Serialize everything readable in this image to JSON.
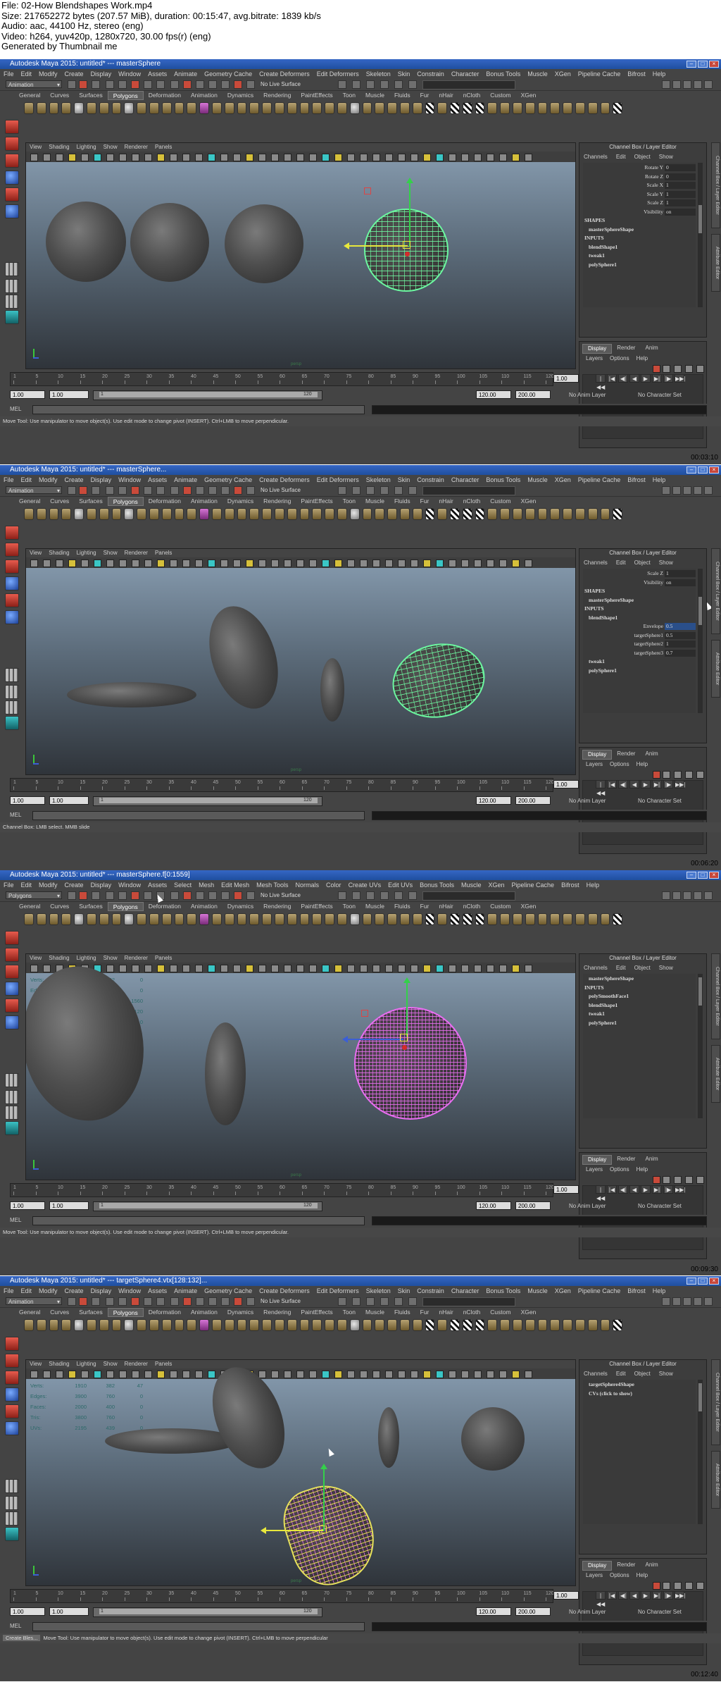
{
  "header": {
    "file": "File: 02-How Blendshapes Work.mp4",
    "size": "Size: 217652272 bytes (207.57 MiB), duration: 00:15:47, avg.bitrate: 1839 kb/s",
    "audio": "Audio: aac, 44100 Hz, stereo (eng)",
    "video": "Video: h264, yuv420p, 1280x720, 30.00 fps(r) (eng)",
    "generator": "Generated by Thumbnail me"
  },
  "common": {
    "menus_animation": [
      "File",
      "Edit",
      "Modify",
      "Create",
      "Display",
      "Window",
      "Assets",
      "Animate",
      "Geometry Cache",
      "Create Deformers",
      "Edit Deformers",
      "Skeleton",
      "Skin",
      "Constrain",
      "Character",
      "Bonus Tools",
      "Muscle",
      "XGen",
      "Pipeline Cache",
      "Bifrost",
      "Help"
    ],
    "menus_polygons": [
      "File",
      "Edit",
      "Modify",
      "Create",
      "Display",
      "Window",
      "Assets",
      "Select",
      "Mesh",
      "Edit Mesh",
      "Mesh Tools",
      "Normals",
      "Color",
      "Create UVs",
      "Edit UVs",
      "Bonus Tools",
      "Muscle",
      "XGen",
      "Pipeline Cache",
      "Bifrost",
      "Help"
    ],
    "shelf_tabs": [
      "General",
      "Curves",
      "Surfaces",
      "Polygons",
      "Deformation",
      "Animation",
      "Dynamics",
      "Rendering",
      "PaintEffects",
      "Toon",
      "Muscle",
      "Fluids",
      "Fur",
      "nHair",
      "nCloth",
      "Custom",
      "XGen"
    ],
    "shelf_selected": "Polygons",
    "live_surface": "No Live Surface",
    "viewport_menu": [
      "View",
      "Shading",
      "Lighting",
      "Show",
      "Renderer",
      "Panels"
    ],
    "channel_box_title": "Channel Box / Layer Editor",
    "channel_menu": [
      "Channels",
      "Edit",
      "Object",
      "Show"
    ],
    "layer_tabs": [
      "Display",
      "Render",
      "Anim"
    ],
    "layer_menu": [
      "Layers",
      "Options",
      "Help"
    ],
    "side_tabs": [
      "Channel Box / Layer Editor",
      "Attribute Editor"
    ],
    "time_ticks": [
      "1",
      "5",
      "10",
      "15",
      "20",
      "25",
      "30",
      "35",
      "40",
      "45",
      "50",
      "55",
      "60",
      "65",
      "70",
      "75",
      "80",
      "85",
      "90",
      "95",
      "100",
      "105",
      "110",
      "115",
      "120"
    ],
    "current_frame": "1.00",
    "range_start": "1.00",
    "range_start2": "1.00",
    "range_inner_start": "1",
    "range_inner_end": "120",
    "range_end": "120.00",
    "range_end2": "200.00",
    "anim_layer": "No Anim Layer",
    "char_set": "No Character Set",
    "mel": "MEL",
    "persp": "persp",
    "play_buttons": [
      "|◀◀",
      "|◀",
      "◀|",
      "◀",
      "▶",
      "▶|",
      "|▶",
      "▶▶|"
    ]
  },
  "frames": [
    {
      "title": "Autodesk Maya 2015: untitled*   ---   masterSphere",
      "menu_set": "Animation",
      "timestamp": "00:03:10",
      "help": "Move Tool: Use manipulator to move object(s). Use edit mode to change pivot (INSERT).  Ctrl+LMB to move perpendicular.",
      "channels": [
        {
          "a": "Rotate Y",
          "v": "0"
        },
        {
          "a": "Rotate Z",
          "v": "0"
        },
        {
          "a": "Scale X",
          "v": "1"
        },
        {
          "a": "Scale Y",
          "v": "1"
        },
        {
          "a": "Scale Z",
          "v": "1"
        },
        {
          "a": "Visibility",
          "v": "on"
        }
      ],
      "sections": [
        "SHAPES",
        "masterSphereShape",
        "INPUTS",
        "blendShape1",
        "tweak1",
        "polySphere1"
      ]
    },
    {
      "title": "Autodesk Maya 2015: untitled*   ---   masterSphere...",
      "menu_set": "Animation",
      "timestamp": "00:06:20",
      "help": "Channel Box: LMB select. MMB slide",
      "channels": [
        {
          "a": "Scale Z",
          "v": "1"
        },
        {
          "a": "Visibility",
          "v": "on"
        }
      ],
      "sections": [
        "SHAPES",
        "masterSphereShape",
        "INPUTS",
        "blendShape1"
      ],
      "blend": [
        {
          "a": "Envelope",
          "v": "0.5"
        },
        {
          "a": "targetSphere1",
          "v": "0.5"
        },
        {
          "a": "targetSphere2",
          "v": "1"
        },
        {
          "a": "targetSphere3",
          "v": "0.7"
        }
      ],
      "after": [
        "tweak1",
        "polySphere1"
      ]
    },
    {
      "title": "Autodesk Maya 2015: untitled*   ---   masterSphere.f[0:1559]",
      "menu_set": "Polygons",
      "timestamp": "00:09:30",
      "help": "Move Tool: Use manipulator to move object(s). Use edit mode to change pivot (INSERT).  Ctrl+LMB to move perpendicular.",
      "hud": [
        {
          "l": "Verts:",
          "a": "2708",
          "b": "1582",
          "c": "0"
        },
        {
          "l": "Edges:",
          "a": "5460",
          "b": "3120",
          "c": "0"
        },
        {
          "l": "Faces:",
          "a": "2760",
          "b": "1560",
          "c": "1560"
        },
        {
          "l": "Tris:",
          "a": "5400",
          "b": "3120",
          "c": "3120"
        },
        {
          "l": "UVs:",
          "a": "2994",
          "b": "1677",
          "c": "0"
        }
      ],
      "sections": [
        "masterSphereShape",
        "INPUTS",
        "polySmoothFace1",
        "blendShape1",
        "tweak1",
        "polySphere1"
      ]
    },
    {
      "title": "Autodesk Maya 2015: untitled*   ---   targetSphere4.vtx[128:132]...",
      "menu_set": "Animation",
      "timestamp": "00:12:40",
      "help": "Move Tool: Use manipulator to move object(s). Use edit mode to change pivot (INSERT).  Ctrl+LMB to move perpendicular",
      "help_prefix": "Create Bles...",
      "hud": [
        {
          "l": "Verts:",
          "a": "1910",
          "b": "382",
          "c": "47"
        },
        {
          "l": "Edges:",
          "a": "3900",
          "b": "760",
          "c": "0"
        },
        {
          "l": "Faces:",
          "a": "2000",
          "b": "400",
          "c": "0"
        },
        {
          "l": "Tris:",
          "a": "3800",
          "b": "760",
          "c": "0"
        },
        {
          "l": "UVs:",
          "a": "2195",
          "b": "439",
          "c": "0"
        }
      ],
      "sections": [
        "targetSphere4Shape",
        "CVs (click to show)"
      ]
    }
  ]
}
